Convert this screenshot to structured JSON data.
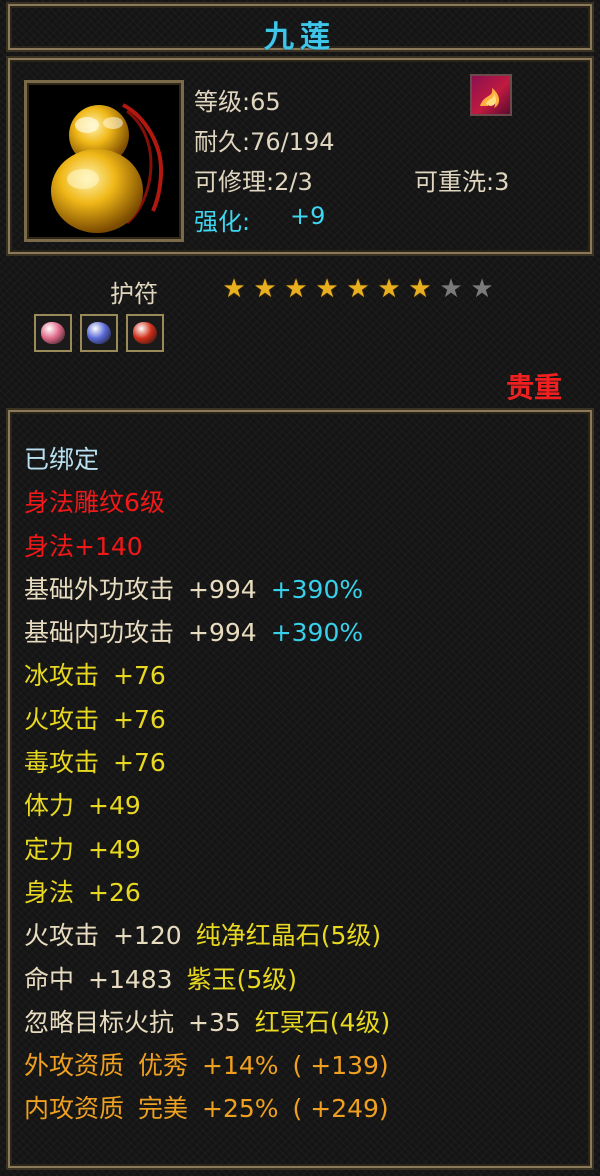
{
  "item": {
    "name": "九莲",
    "level": "等级:65",
    "durability": "耐久:76/194",
    "repair": "可修理:2/3",
    "rewash": "可重洗:3",
    "enhance_label": "强化:",
    "enhance_value": "+9"
  },
  "category": {
    "type": "护符",
    "stars_total": 9,
    "stars_filled": 7,
    "rarity": "贵重",
    "gems": [
      {
        "name": "pink-gem",
        "color": "#e06a8a"
      },
      {
        "name": "blue-gem",
        "color": "#5a6ad8"
      },
      {
        "name": "red-gem",
        "color": "#d0301a"
      }
    ]
  },
  "attributes": [
    {
      "parts": [
        {
          "text": "已绑定",
          "color": "blue"
        }
      ]
    },
    {
      "parts": [
        {
          "text": "身法雕纹6级",
          "color": "red"
        }
      ]
    },
    {
      "parts": [
        {
          "text": "身法+140",
          "color": "red"
        }
      ]
    },
    {
      "parts": [
        {
          "text": "基础外功攻击",
          "color": "cream"
        },
        {
          "text": "+994",
          "color": "cream"
        },
        {
          "text": "+390%",
          "color": "cyan"
        }
      ]
    },
    {
      "parts": [
        {
          "text": "基础内功攻击",
          "color": "cream"
        },
        {
          "text": "+994",
          "color": "cream"
        },
        {
          "text": "+390%",
          "color": "cyan"
        }
      ]
    },
    {
      "parts": [
        {
          "text": "冰攻击",
          "color": "yellow"
        },
        {
          "text": "+76",
          "color": "yellow"
        }
      ]
    },
    {
      "parts": [
        {
          "text": "火攻击",
          "color": "yellow"
        },
        {
          "text": "+76",
          "color": "yellow"
        }
      ]
    },
    {
      "parts": [
        {
          "text": "毒攻击",
          "color": "yellow"
        },
        {
          "text": "+76",
          "color": "yellow"
        }
      ]
    },
    {
      "parts": [
        {
          "text": "体力",
          "color": "yellow"
        },
        {
          "text": "+49",
          "color": "yellow"
        }
      ]
    },
    {
      "parts": [
        {
          "text": "定力",
          "color": "yellow"
        },
        {
          "text": "+49",
          "color": "yellow"
        }
      ]
    },
    {
      "parts": [
        {
          "text": "身法",
          "color": "yellow"
        },
        {
          "text": "+26",
          "color": "yellow"
        }
      ]
    },
    {
      "parts": [
        {
          "text": "火攻击",
          "color": "cream"
        },
        {
          "text": "+120",
          "color": "cream"
        },
        {
          "text": "纯净红晶石(5级)",
          "color": "yellow"
        }
      ]
    },
    {
      "parts": [
        {
          "text": "命中",
          "color": "cream"
        },
        {
          "text": "+1483",
          "color": "cream"
        },
        {
          "text": "紫玉(5级)",
          "color": "yellow"
        }
      ]
    },
    {
      "parts": [
        {
          "text": "忽略目标火抗",
          "color": "cream"
        },
        {
          "text": "+35",
          "color": "cream"
        },
        {
          "text": "红冥石(4级)",
          "color": "yellow"
        }
      ]
    },
    {
      "parts": [
        {
          "text": "外攻资质",
          "color": "orange"
        },
        {
          "text": "优秀",
          "color": "orange"
        },
        {
          "text": "+14%",
          "color": "orange"
        },
        {
          "text": "( +139)",
          "color": "orange"
        }
      ]
    },
    {
      "parts": [
        {
          "text": "内攻资质",
          "color": "orange"
        },
        {
          "text": "完美",
          "color": "orange"
        },
        {
          "text": "+25%",
          "color": "orange"
        },
        {
          "text": "( +249)",
          "color": "orange"
        }
      ]
    }
  ]
}
